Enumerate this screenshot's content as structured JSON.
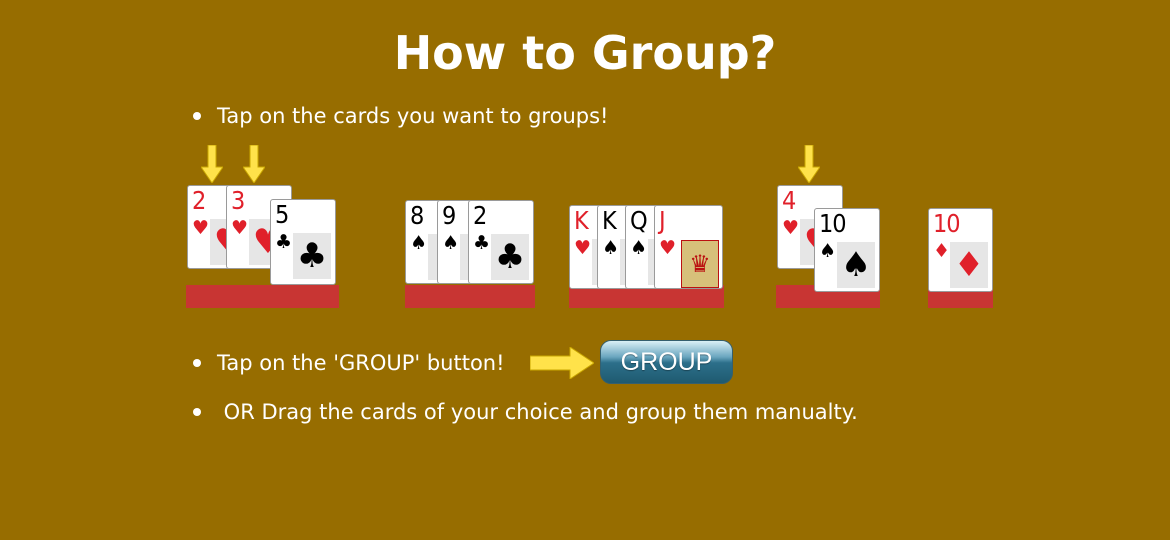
{
  "title": "How to Group?",
  "steps": [
    "Tap on the cards you want to groups!",
    "Tap on the 'GROUP' button!",
    " OR Drag the cards of your choice and group them manualty."
  ],
  "group_button_label": "GROUP",
  "colors": {
    "background": "#976d00",
    "bar": "#c83533",
    "arrow": "#ffe24a"
  },
  "card_groups": [
    {
      "cards": [
        {
          "rank": "2",
          "suit": "♥"
        },
        {
          "rank": "3",
          "suit": "♥"
        },
        {
          "rank": "5",
          "suit": "♣"
        }
      ]
    },
    {
      "cards": [
        {
          "rank": "8",
          "suit": "♠"
        },
        {
          "rank": "9",
          "suit": "♠"
        },
        {
          "rank": "2",
          "suit": "♣"
        }
      ]
    },
    {
      "cards": [
        {
          "rank": "K",
          "suit": "♥"
        },
        {
          "rank": "K",
          "suit": "♠"
        },
        {
          "rank": "Q",
          "suit": "♠"
        },
        {
          "rank": "J",
          "suit": "♥"
        }
      ]
    },
    {
      "cards": [
        {
          "rank": "4",
          "suit": "♥"
        },
        {
          "rank": "10",
          "suit": "♠"
        }
      ]
    },
    {
      "cards": [
        {
          "rank": "10",
          "suit": "♦"
        }
      ]
    }
  ]
}
